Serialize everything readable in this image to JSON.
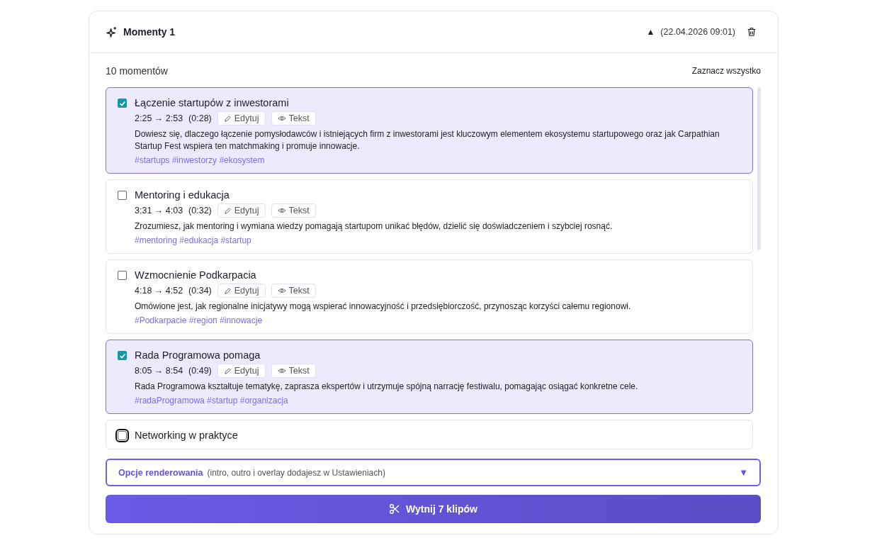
{
  "header": {
    "title": "Momenty 1",
    "sort_indicator": "▲",
    "timestamp": "(22.04.2026 09:01)"
  },
  "count": "10 momentów",
  "select_all": "Zaznacz wszystko",
  "moments": [
    {
      "title": "Łączenie startupów z inwestorami",
      "checked": true,
      "focused": false,
      "time": "2:25 → 2:53",
      "duration": "(0:28)",
      "edit": "Edytuj",
      "text": "Tekst",
      "description": "Dowiesz się, dlaczego łączenie pomysłodawców i istniejących firm z inwestorami jest kluczowym elementem ekosystemu startupowego oraz jak Carpathian Startup Fest wspiera ten matchmaking i promuje innowacje.",
      "tags": "#startups #inwestorzy #ekosystem"
    },
    {
      "title": "Mentoring i edukacja",
      "checked": false,
      "focused": false,
      "time": "3:31 → 4:03",
      "duration": "(0:32)",
      "edit": "Edytuj",
      "text": "Tekst",
      "description": "Zrozumiesz, jak mentoring i wymiana wiedzy pomagają startupom unikać błędów, dzielić się doświadczeniem i szybciej rosnąć.",
      "tags": "#mentoring #edukacja #startup"
    },
    {
      "title": "Wzmocnienie Podkarpacia",
      "checked": false,
      "focused": false,
      "time": "4:18 → 4:52",
      "duration": "(0:34)",
      "edit": "Edytuj",
      "text": "Tekst",
      "description": "Omówione jest, jak regionalne inicjatywy mogą wspierać innowacyjność i przedsiębiorczość, przynosząc korzyści całemu regionowi.",
      "tags": "#Podkarpacie #region #innowacje"
    },
    {
      "title": "Rada Programowa pomaga",
      "checked": true,
      "focused": false,
      "time": "8:05 → 8:54",
      "duration": "(0:49)",
      "edit": "Edytuj",
      "text": "Tekst",
      "description": "Rada Programowa kształtuje tematykę, zaprasza ekspertów i utrzymuje spójną narrację festiwalu, pomagając osiągać konkretne cele.",
      "tags": "#radaProgramowa #startup #organizacja"
    },
    {
      "title": "Networking w praktyce",
      "checked": false,
      "focused": true
    }
  ],
  "render_options": {
    "label": "Opcje renderowania",
    "hint": "(intro, outro i overlay dodajesz w Ustawieniach)",
    "caret": "▼",
    "expanded": false
  },
  "cut_button": "Wytnij 7 klipów"
}
